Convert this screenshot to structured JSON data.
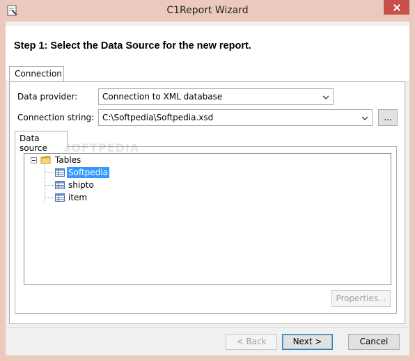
{
  "window": {
    "title": "C1Report Wizard",
    "app_icon": "report-wizard-icon",
    "close_icon": "close-icon"
  },
  "header": {
    "step_title": "Step 1: Select the Data Source for the new report."
  },
  "tabs": {
    "connection_tab": "Connection",
    "datasource_tab": "Data source"
  },
  "connection": {
    "data_provider_label": "Data provider:",
    "data_provider_value": "Connection to XML database",
    "connection_string_label": "Connection string:",
    "connection_string_value": "C:\\Softpedia\\Softpedia.xsd",
    "browse_label": "..."
  },
  "tree": {
    "root": "Tables",
    "items": [
      "Softpedia",
      "shipto",
      "item"
    ],
    "selected_index": 0,
    "folder_icon": "folder-icon",
    "table_icon": "table-icon"
  },
  "buttons": {
    "properties": "Properties...",
    "back": "< Back",
    "next": "Next >",
    "cancel": "Cancel"
  },
  "colors": {
    "title_bar": "#ecc9bd",
    "close_button": "#c7504c",
    "selection": "#3399ff"
  }
}
